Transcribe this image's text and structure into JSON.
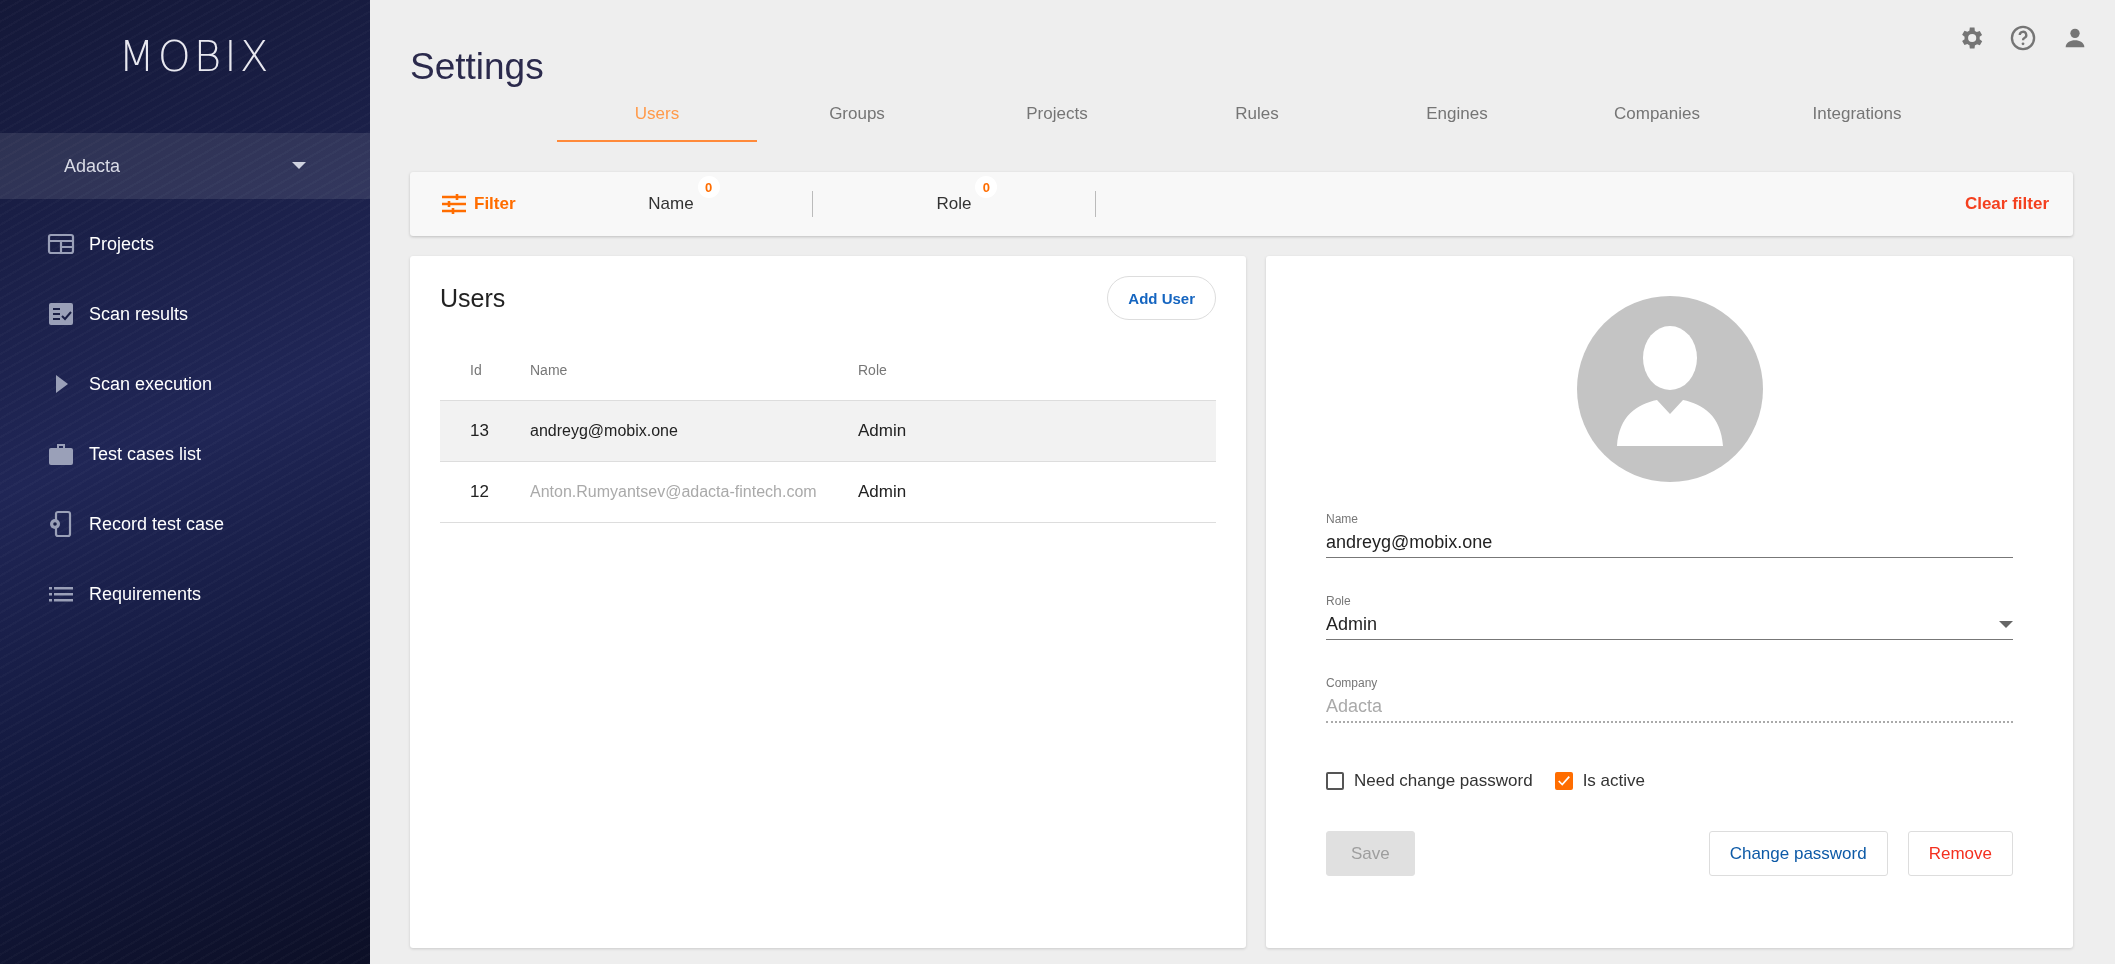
{
  "sidebar": {
    "logo": "MOBIX",
    "company_selector": {
      "value": "Adacta"
    },
    "items": [
      {
        "kind": "projects",
        "label": "Projects"
      },
      {
        "kind": "results",
        "label": "Scan results"
      },
      {
        "kind": "execution",
        "label": "Scan execution"
      },
      {
        "kind": "cases",
        "label": "Test cases list"
      },
      {
        "kind": "record",
        "label": "Record test case"
      },
      {
        "kind": "requirements",
        "label": "Requirements"
      }
    ]
  },
  "page": {
    "title": "Settings"
  },
  "tabs": [
    {
      "label": "Users",
      "selected": true
    },
    {
      "label": "Groups",
      "selected": false
    },
    {
      "label": "Projects",
      "selected": false
    },
    {
      "label": "Rules",
      "selected": false
    },
    {
      "label": "Engines",
      "selected": false
    },
    {
      "label": "Companies",
      "selected": false
    },
    {
      "label": "Integrations",
      "selected": false
    }
  ],
  "filter_bar": {
    "label": "Filter",
    "fields": [
      {
        "label": "Name",
        "count": "0"
      },
      {
        "label": "Role",
        "count": "0"
      }
    ],
    "clear": "Clear filter"
  },
  "users_panel": {
    "title": "Users",
    "add_button": "Add User",
    "table": {
      "columns": [
        "Id",
        "Name",
        "Role"
      ],
      "rows": [
        {
          "id": "13",
          "name": "andreyg@mobix.one",
          "role": "Admin",
          "selected": true
        },
        {
          "id": "12",
          "name": "Anton.Rumyantsev@adacta-fintech.com",
          "role": "Admin",
          "selected": false
        }
      ]
    }
  },
  "user_form": {
    "fields": [
      {
        "kind": "text",
        "label": "Name",
        "value": "andreyg@mobix.one",
        "disabled": false
      },
      {
        "kind": "select",
        "label": "Role",
        "value": "Admin",
        "disabled": false
      },
      {
        "kind": "text",
        "label": "Company",
        "value": "Adacta",
        "disabled": true
      }
    ],
    "checkboxes": [
      {
        "label": "Need change password",
        "checked": false
      },
      {
        "label": "Is active",
        "checked": true
      }
    ],
    "buttons": [
      {
        "kind": "save",
        "label": "Save",
        "disabled": true
      },
      {
        "kind": "change",
        "label": "Change password",
        "disabled": false
      },
      {
        "kind": "remove",
        "label": "Remove",
        "disabled": false
      }
    ]
  }
}
